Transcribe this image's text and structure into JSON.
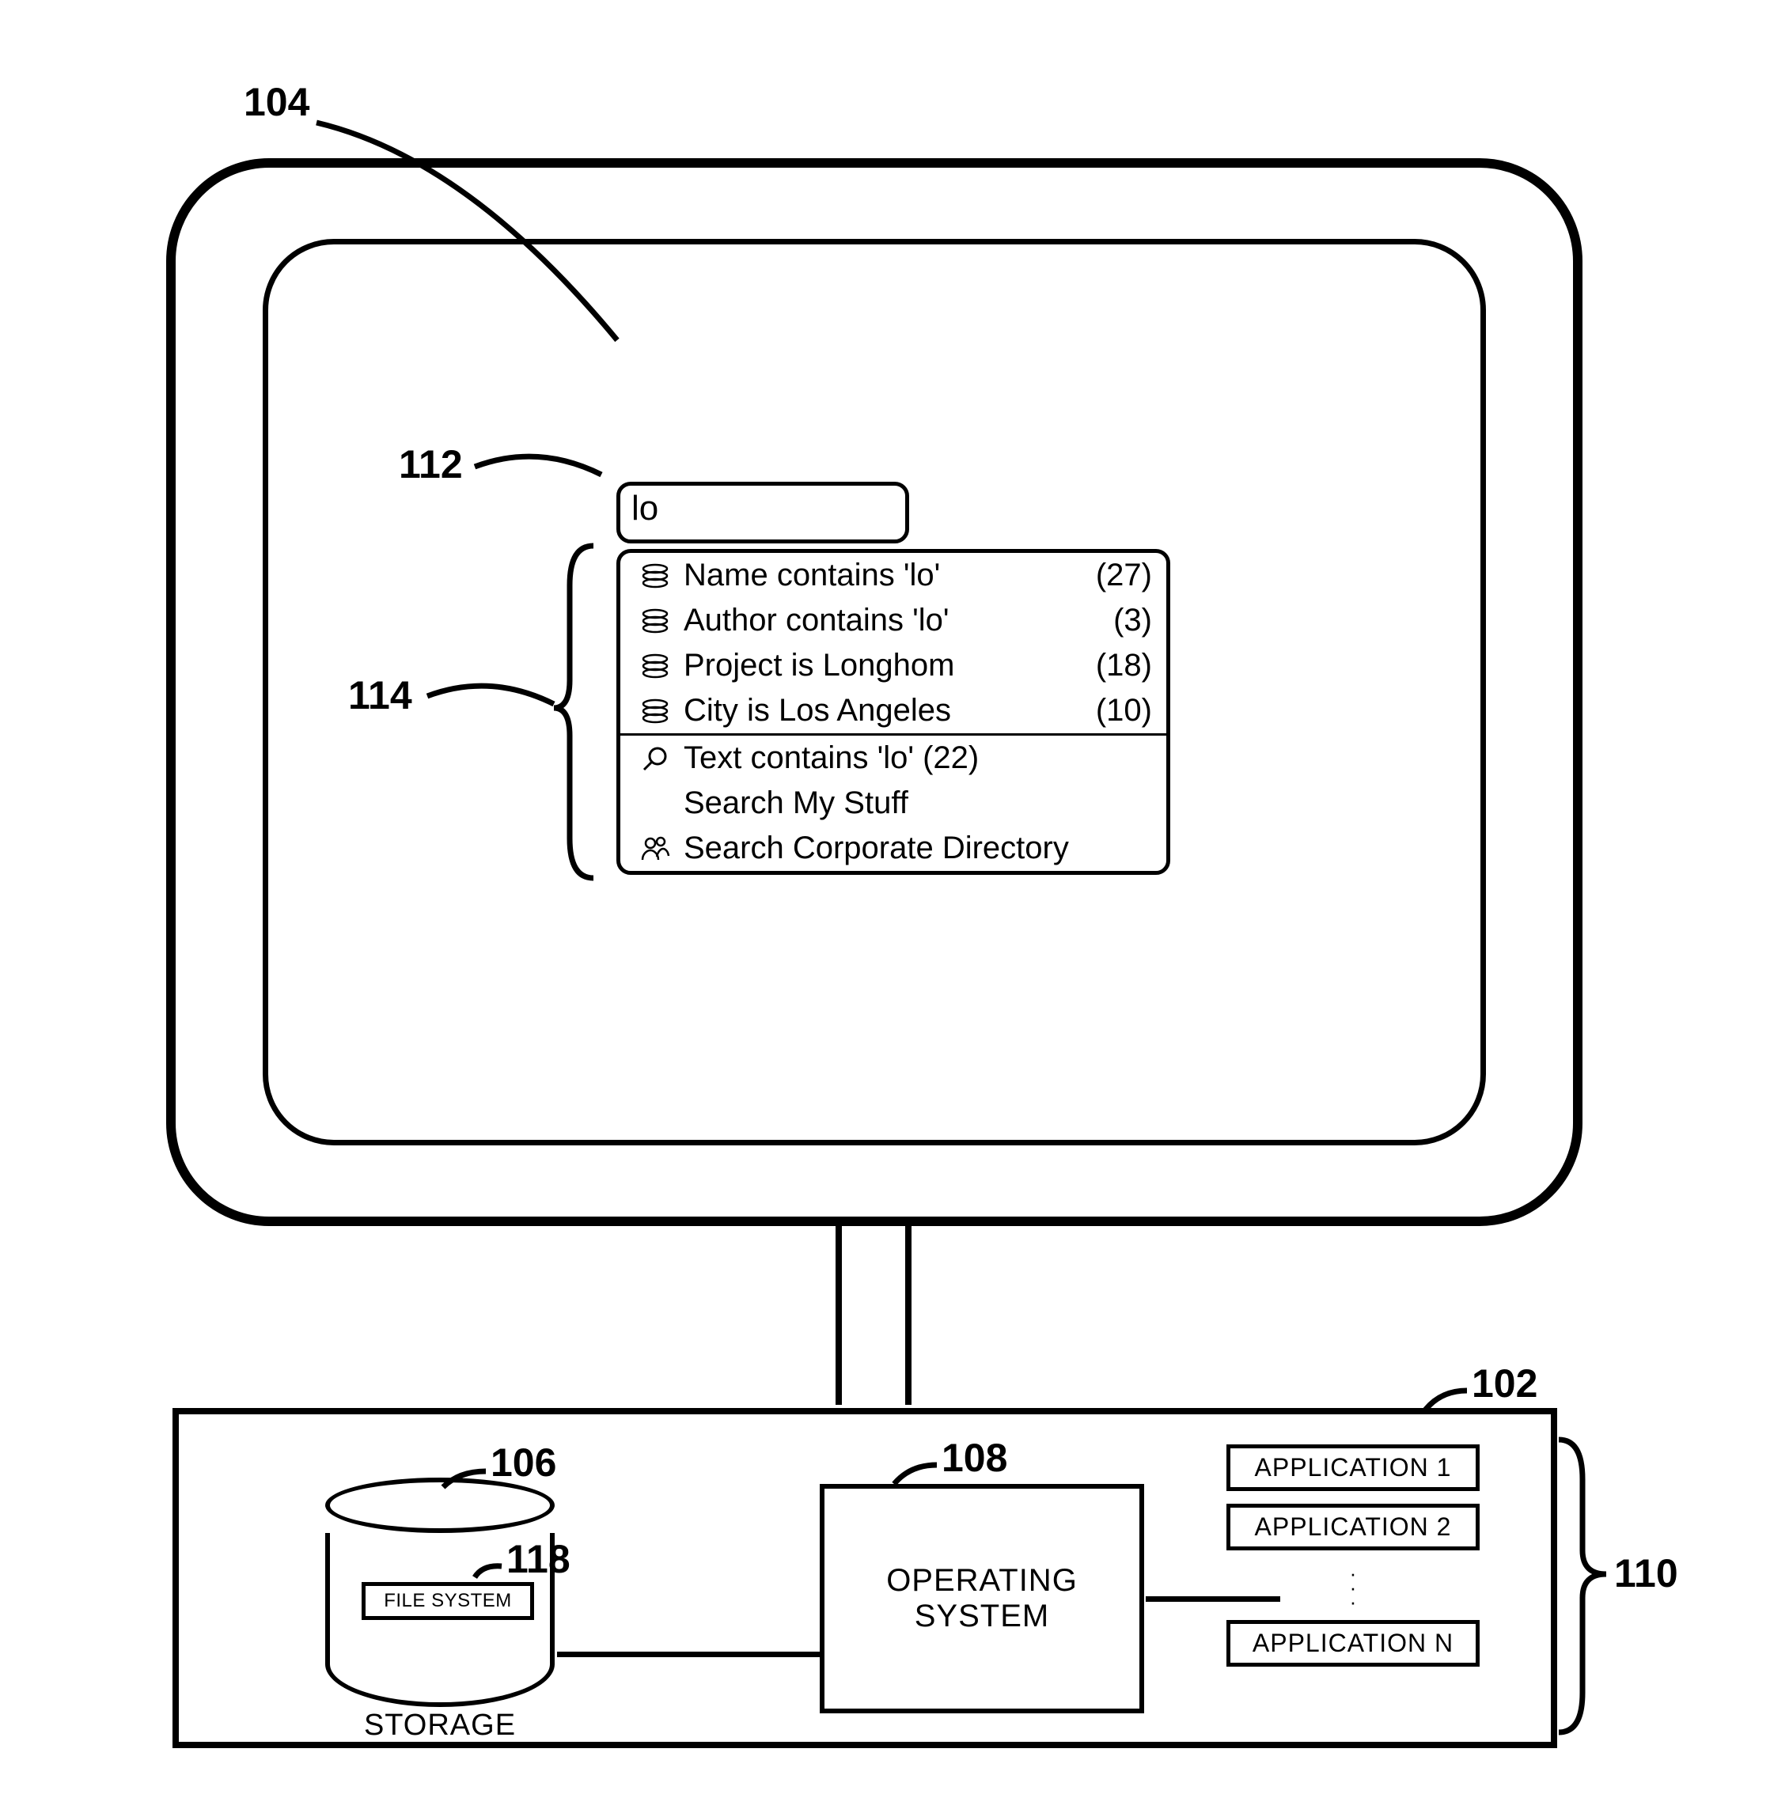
{
  "labels": {
    "monitor": "104",
    "searchbox": "112",
    "suggestions": "114",
    "base": "102",
    "storage_cyl": "106",
    "file_system_box": "118",
    "os_box": "108",
    "apps": "110"
  },
  "search": {
    "value": "lo"
  },
  "suggestions": {
    "group_filters": [
      {
        "icon": "stack-icon",
        "label": "Name contains 'lo'",
        "count": "(27)"
      },
      {
        "icon": "stack-icon",
        "label": "Author contains 'lo'",
        "count": "(3)"
      },
      {
        "icon": "stack-icon",
        "label": "Project is Longhom",
        "count": "(18)"
      },
      {
        "icon": "stack-icon",
        "label": "City is Los Angeles",
        "count": "(10)"
      }
    ],
    "group_actions": [
      {
        "icon": "search-icon",
        "label": "Text contains 'lo'   (22)"
      },
      {
        "icon": "blank-icon",
        "label": "Search My Stuff"
      },
      {
        "icon": "people-icon",
        "label": "Search Corporate Directory"
      }
    ]
  },
  "base": {
    "file_system": "FILE SYSTEM",
    "storage": "STORAGE",
    "os_line1": "OPERATING",
    "os_line2": "SYSTEM",
    "apps": [
      "APPLICATION 1",
      "APPLICATION 2",
      "APPLICATION N"
    ]
  }
}
